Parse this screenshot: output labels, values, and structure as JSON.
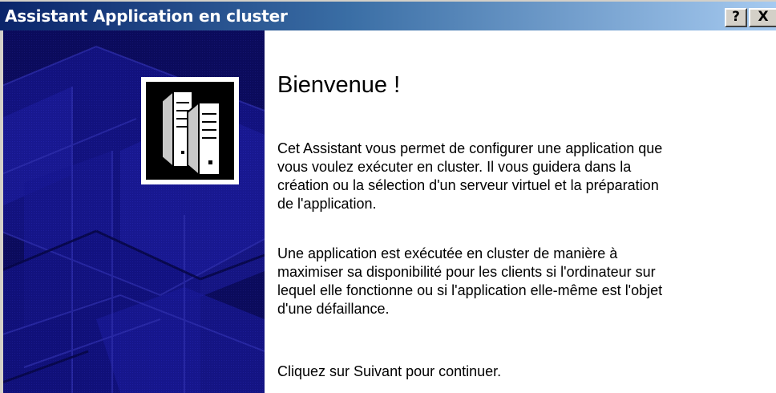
{
  "window": {
    "title": "Assistant Application en cluster",
    "help_label": "?",
    "close_label": "X",
    "title_gradient": [
      "#0a246a",
      "#a6caf0"
    ]
  },
  "sidebar": {
    "background_color": "#0b0b5c",
    "icon": "server-cluster-icon"
  },
  "content": {
    "heading": "Bienvenue !",
    "paragraph1": "Cet Assistant vous permet de configurer une application que\nvous voulez exécuter en cluster. Il vous guidera dans la\ncréation ou la sélection d'un serveur virtuel et la préparation\nde l'application.",
    "paragraph2": "Une application est exécutée en cluster de manière à\nmaximiser sa disponibilité pour les clients si l'ordinateur sur\nlequel elle fonctionne ou si l'application elle-même est l'objet\nd'une défaillance.",
    "paragraph3": "Cliquez sur Suivant pour continuer."
  }
}
